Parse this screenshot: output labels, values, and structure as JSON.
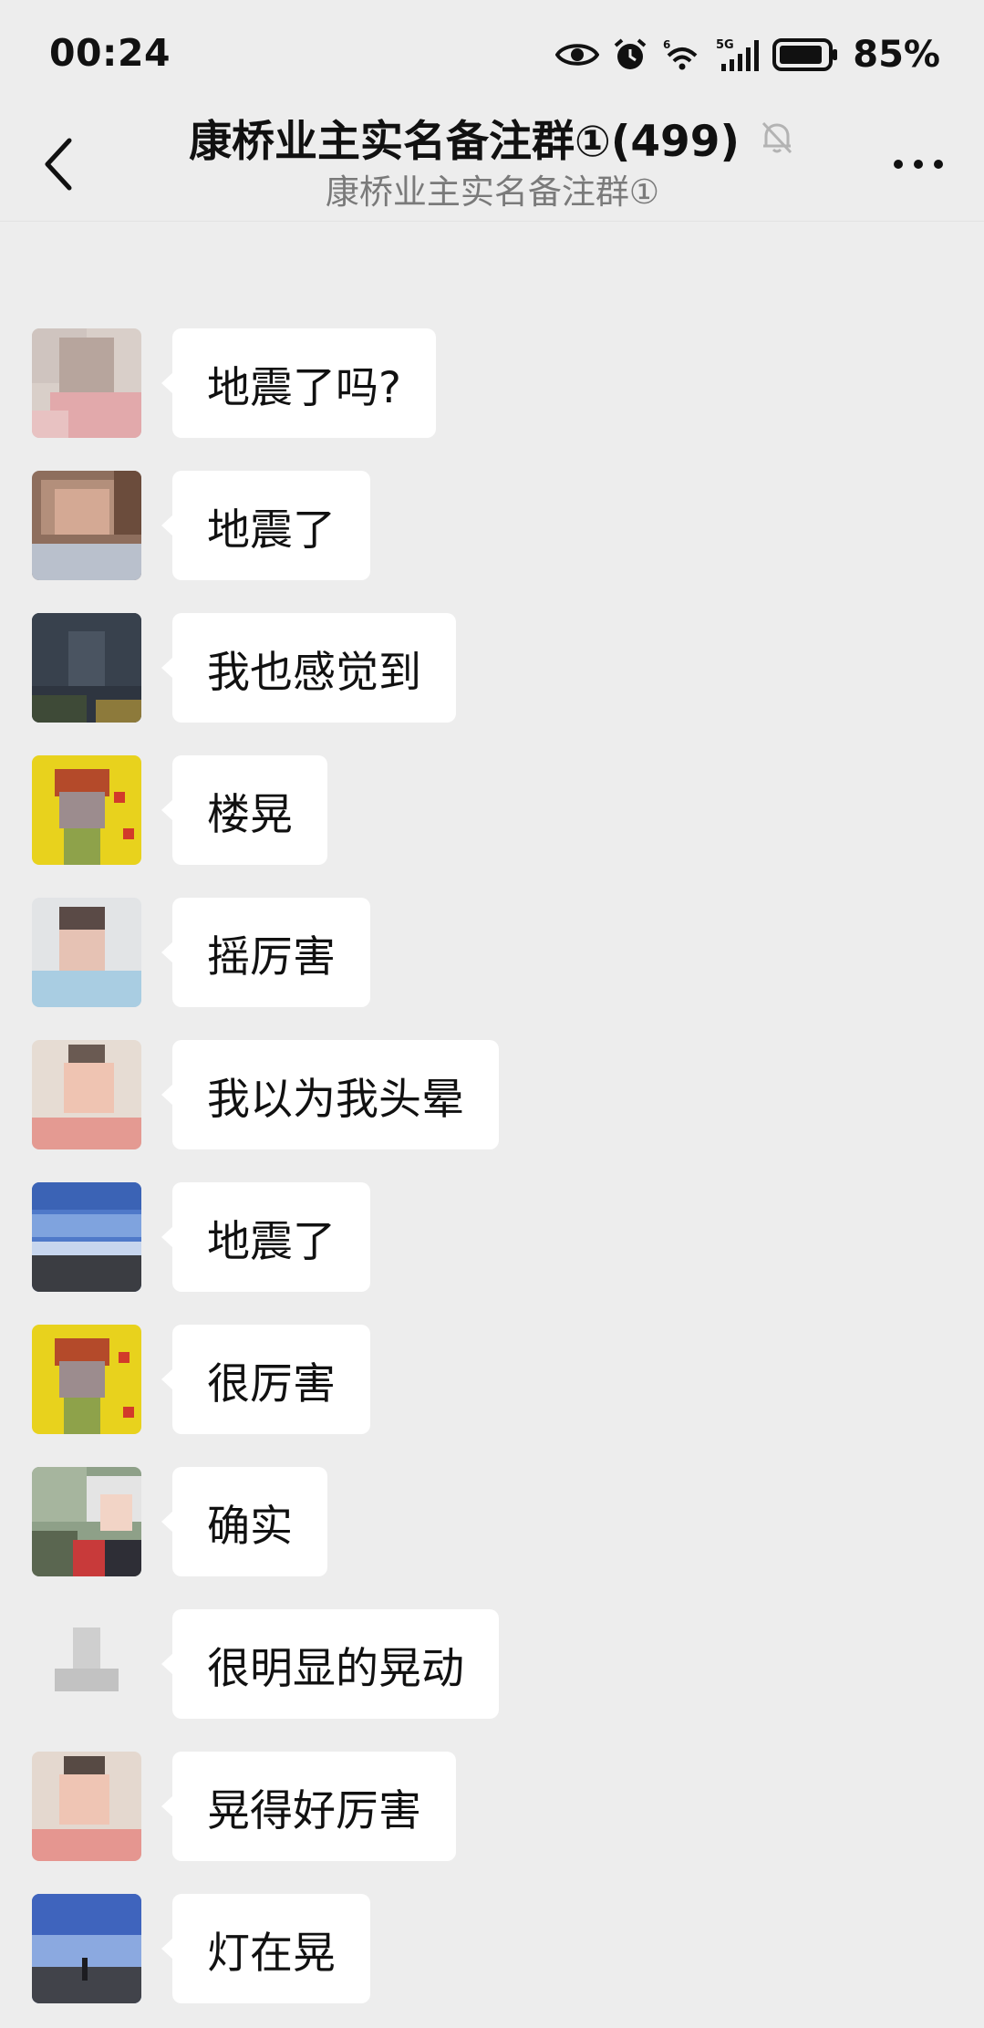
{
  "status_bar": {
    "time": "00:24",
    "battery": "85%",
    "network": "5G",
    "icons": [
      "eye-icon",
      "alarm-icon",
      "wifi-icon",
      "signal-icon",
      "battery-icon"
    ]
  },
  "header": {
    "title": "康桥业主实名备注群①(499)",
    "subtitle": "康桥业主实名备注群①",
    "muted_icon": "bell-off-icon",
    "more_icon": "more-icon",
    "back_icon": "back-icon"
  },
  "messages": [
    {
      "text": "地震了吗?"
    },
    {
      "text": "地震了"
    },
    {
      "text": "我也感觉到"
    },
    {
      "text": "楼晃"
    },
    {
      "text": "摇厉害"
    },
    {
      "text": "我以为我头晕"
    },
    {
      "text": "地震了"
    },
    {
      "text": "很厉害"
    },
    {
      "text": "确实"
    },
    {
      "text": "很明显的晃动"
    },
    {
      "text": "晃得好厉害"
    },
    {
      "text": "灯在晃"
    }
  ],
  "colors": {
    "background": "#ededed",
    "bubble": "#ffffff",
    "text": "#111111",
    "subtitle": "#7a7a7a"
  }
}
